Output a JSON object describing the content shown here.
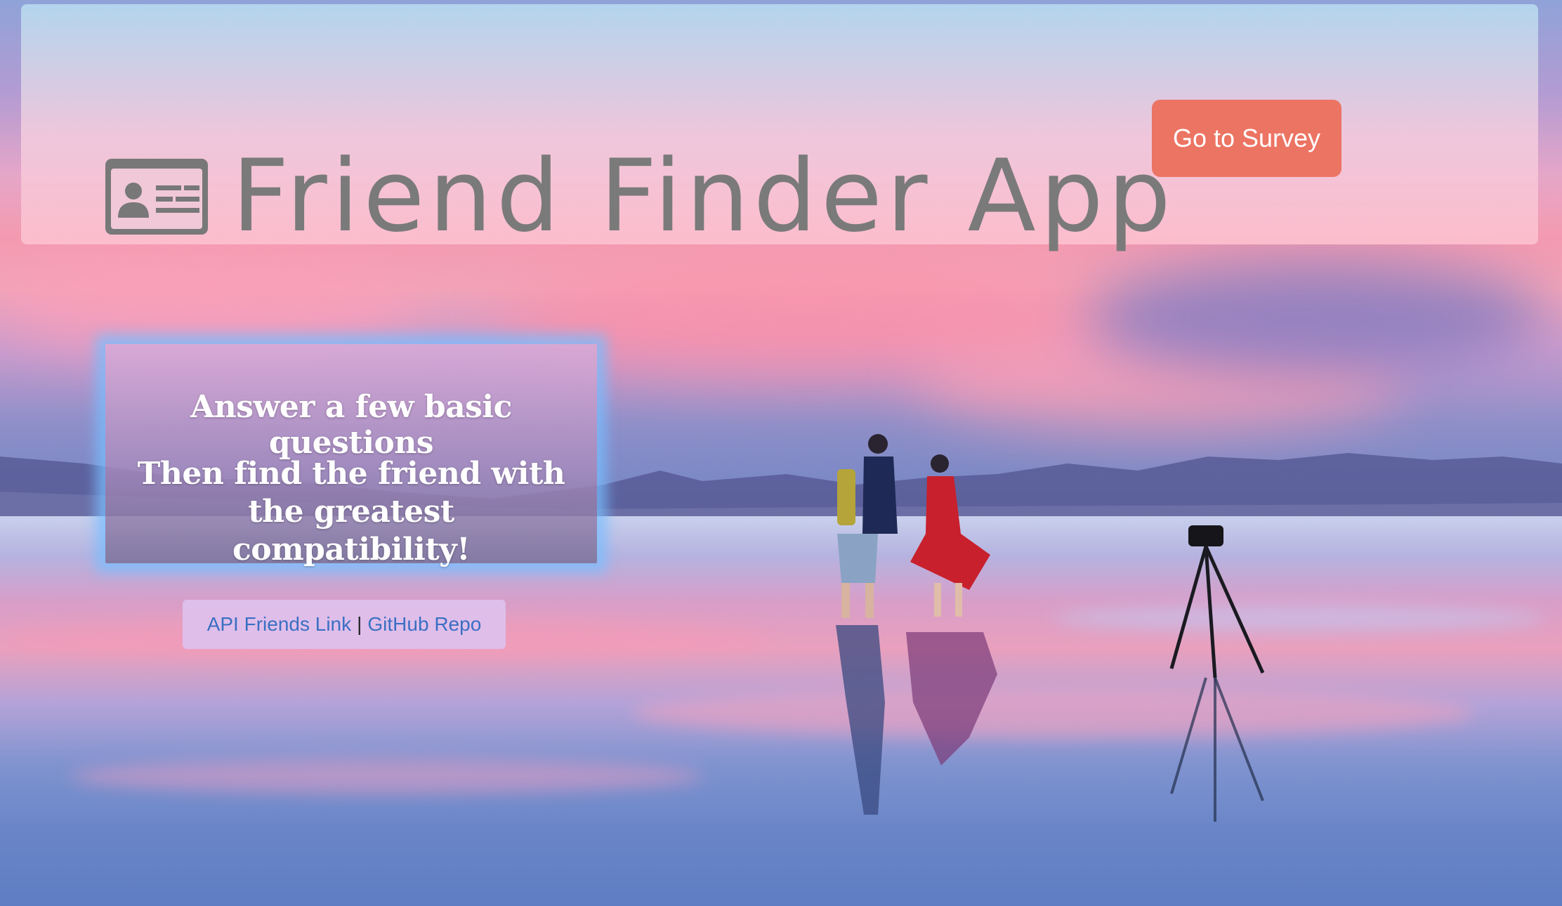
{
  "header": {
    "title": "Friend Finder App",
    "icon": "id-card-icon",
    "survey_button": "Go to Survey"
  },
  "info": {
    "line1": "Answer a few basic questions",
    "line2": "Then find the friend with the greatest compatibility!"
  },
  "links": {
    "api_label": "API Friends Link",
    "separator": "|",
    "github_label": "GitHub Repo"
  },
  "colors": {
    "title_gray": "#7a7a7a",
    "survey_button": "#ec7463",
    "link_blue": "#3b6fc2"
  }
}
